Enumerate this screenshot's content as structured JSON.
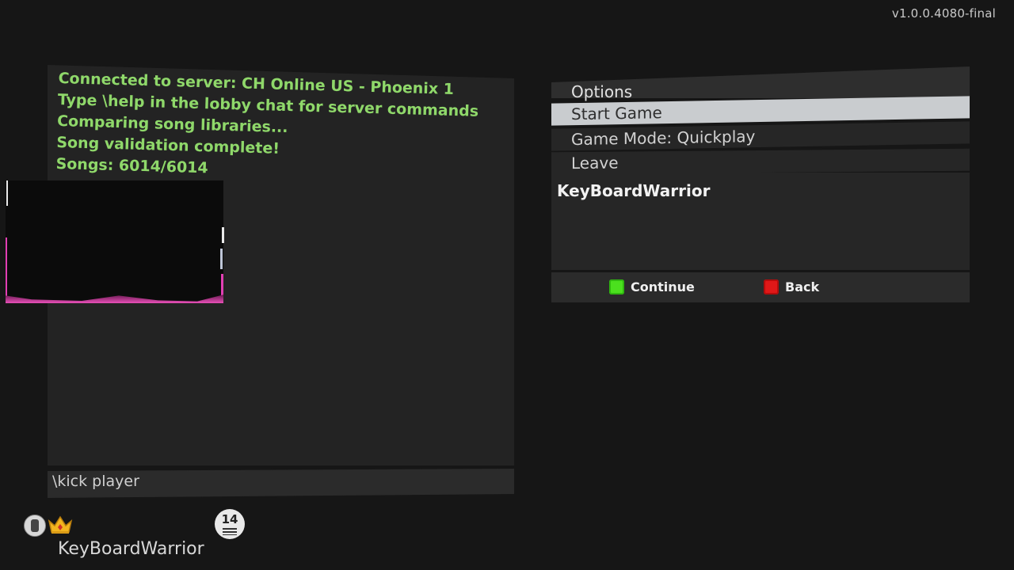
{
  "version": "v1.0.0.4080-final",
  "chat": {
    "lines": [
      "Connected to server: CH Online US - Phoenix 1",
      "Type \\help in the lobby chat for server commands",
      "Comparing song libraries...",
      "Song validation complete!",
      "Songs: 6014/6014"
    ],
    "input_value": "\\kick player"
  },
  "options": {
    "header": "Options",
    "items": [
      {
        "label": "Start Game",
        "selected": true
      },
      {
        "label": "Game Mode: Quickplay",
        "selected": false
      },
      {
        "label": "Leave",
        "selected": false
      }
    ]
  },
  "players": [
    "KeyBoardWarrior"
  ],
  "controls": {
    "continue_label": "Continue",
    "back_label": "Back",
    "colors": {
      "continue": "#4be01e",
      "back": "#e01818"
    }
  },
  "player_card": {
    "name": "KeyBoardWarrior",
    "level": "14",
    "icons": [
      "guitar-icon",
      "crown-icon",
      "level-badge-icon"
    ]
  },
  "colors": {
    "chat_text": "#8fd86a",
    "selected_row": "#c9cccf",
    "background": "#161616"
  }
}
